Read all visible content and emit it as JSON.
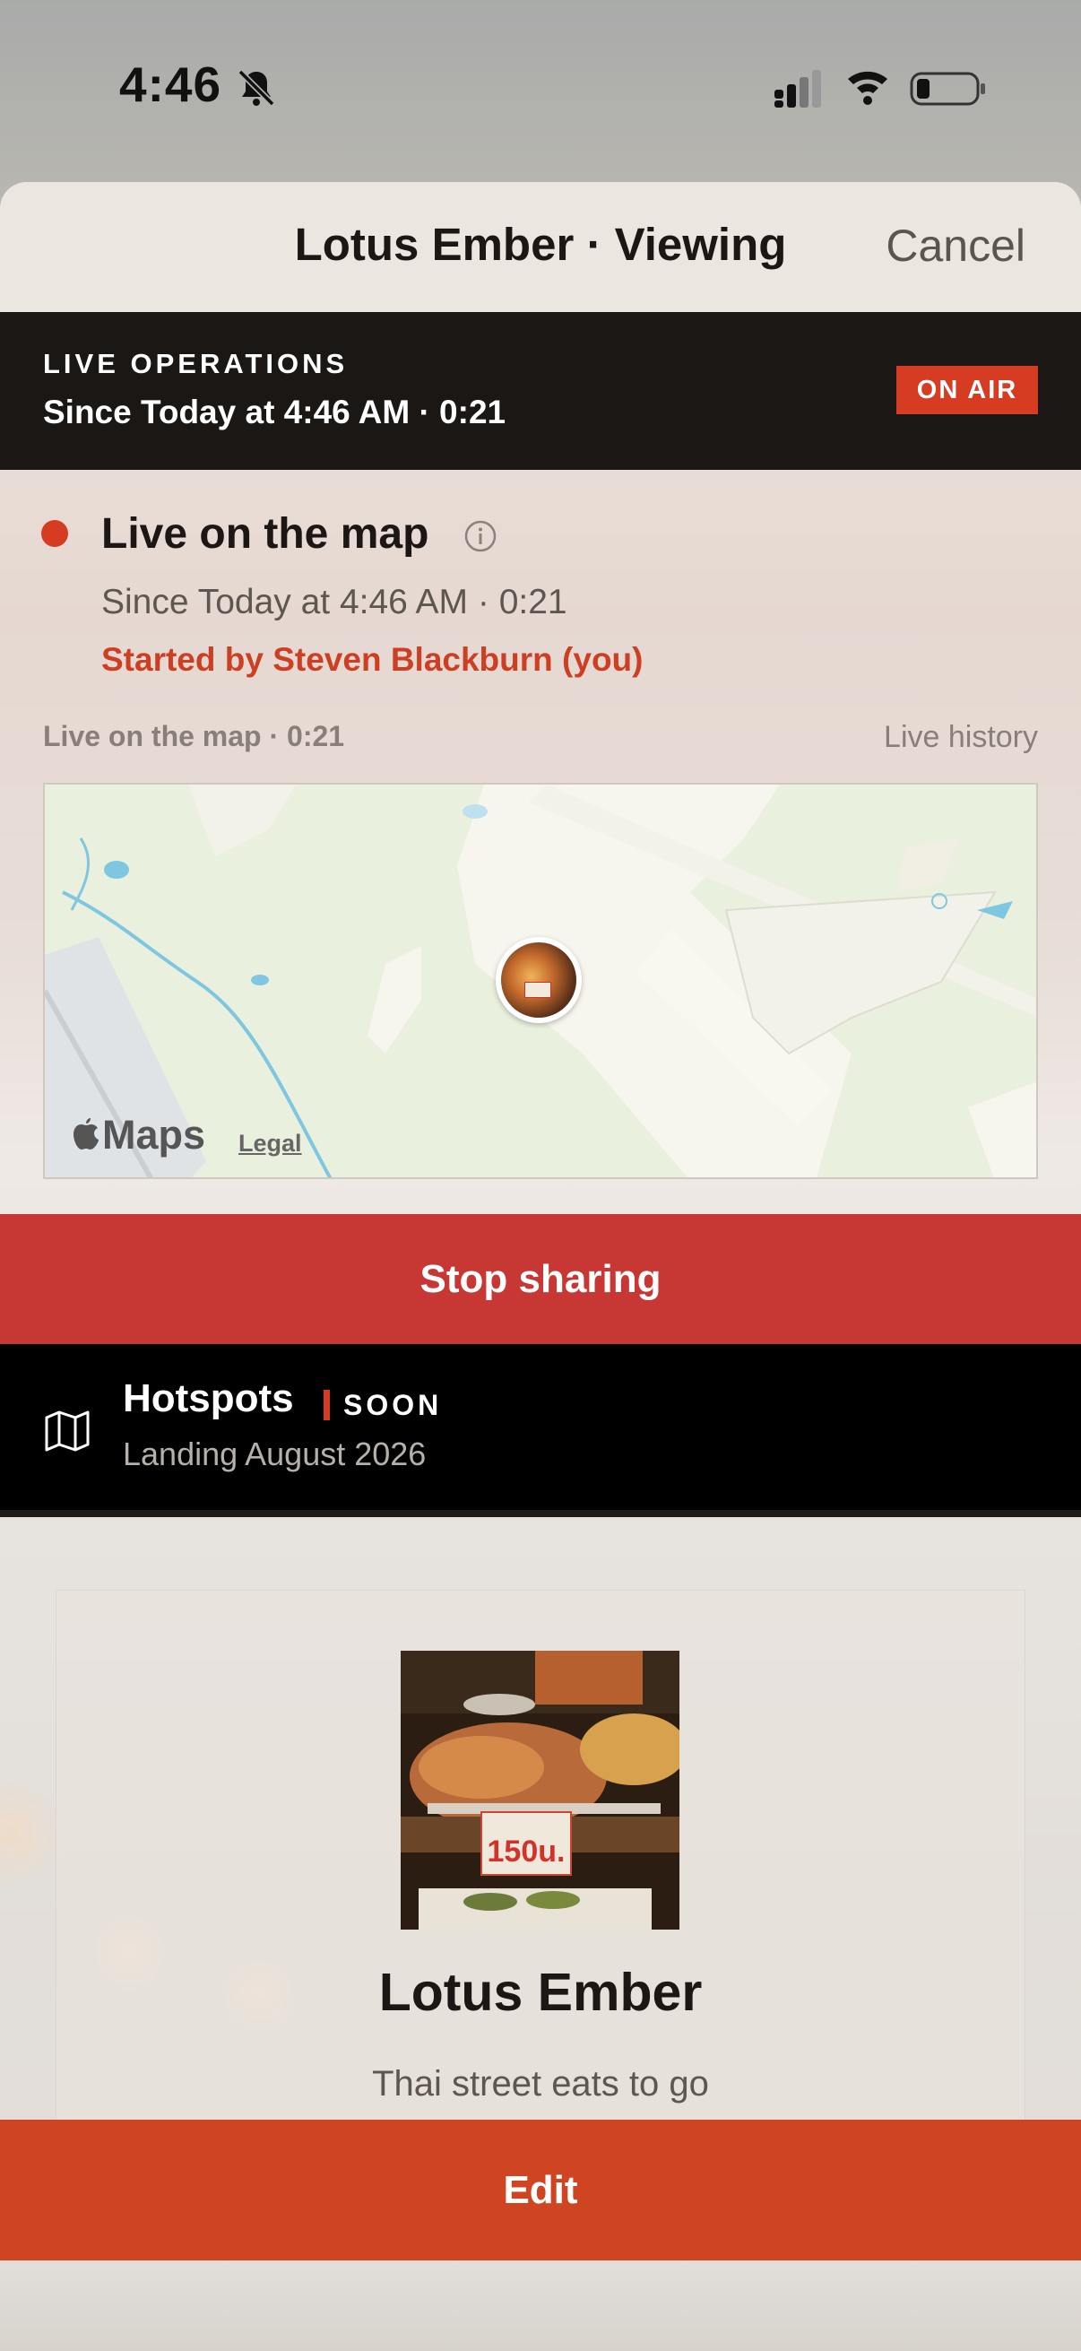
{
  "status_bar": {
    "time": "4:46",
    "icons": [
      "bell-slash-icon",
      "signal-icon",
      "wifi-icon",
      "battery-icon"
    ],
    "battery_level": 0.2
  },
  "nav": {
    "title": "Lotus Ember · Viewing",
    "cancel_label": "Cancel"
  },
  "live_operations": {
    "label": "LIVE OPERATIONS",
    "since": "Since Today at 4:46 AM  ·  0:21",
    "badge": "ON AIR"
  },
  "live_status": {
    "title": "Live on the map",
    "since": "Since Today at 4:46 AM  ·  0:21",
    "started_by": "Started by Steven Blackburn (you)"
  },
  "map_section": {
    "caption": "Live on the map · 0:21",
    "history_link": "Live history",
    "provider_label": "Maps",
    "legal_label": "Legal",
    "pin_sign": "150"
  },
  "stop_button": {
    "label": "Stop sharing"
  },
  "hotspots": {
    "title": "Hotspots",
    "badge": "SOON",
    "subtitle": "Landing August 2026"
  },
  "profile": {
    "name": "Lotus Ember",
    "tagline": "Thai street eats to go",
    "photo_sign": "150u."
  },
  "edit_button": {
    "label": "Edit"
  },
  "colors": {
    "accent": "#d63c22",
    "stop": "#c73733",
    "edit": "#cf4521",
    "dark": "#1b1715"
  }
}
